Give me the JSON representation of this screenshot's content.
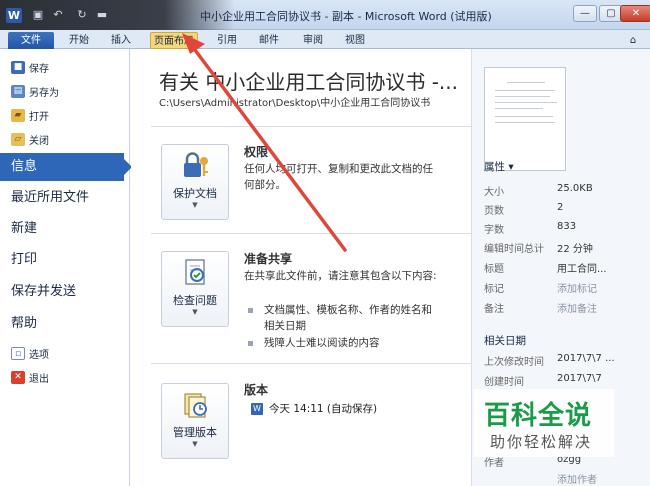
{
  "window": {
    "title": "中小企业用工合同协议书 - 副本 - Microsoft Word (试用版)",
    "controls": [
      "—",
      "▢",
      "✕"
    ]
  },
  "ribbon_tabs": [
    "文件",
    "开始",
    "插入",
    "页面布局",
    "引用",
    "邮件",
    "审阅",
    "视图"
  ],
  "left_nav": {
    "small_items": [
      {
        "label": "保存",
        "icon": "save-icon"
      },
      {
        "label": "另存为",
        "icon": "save-as-icon"
      },
      {
        "label": "打开",
        "icon": "open-folder-icon"
      },
      {
        "label": "关闭",
        "icon": "close-folder-icon"
      }
    ],
    "big_items": [
      "信息",
      "最近所用文件",
      "新建",
      "打印",
      "保存并发送",
      "帮助"
    ],
    "bottom_items": [
      {
        "label": "选项",
        "icon": "options-icon"
      },
      {
        "label": "退出",
        "icon": "exit-icon"
      }
    ]
  },
  "info": {
    "doc_title": "有关 中小企业用工合同协议书 -...",
    "doc_path": "C:\\Users\\Administrator\\Desktop\\中小企业用工合同协议书",
    "sections": [
      {
        "button": "保护文档",
        "title": "权限",
        "desc": "任何人均可打开、复制和更改此文档的任何部分。"
      },
      {
        "button": "检查问题",
        "title": "准备共享",
        "desc": "在共享此文件前，请注意其包含以下内容:",
        "bullets": [
          "文档属性、模板名称、作者的姓名和相关日期",
          "残障人士难以阅读的内容"
        ]
      },
      {
        "button": "管理版本",
        "title": "版本",
        "entry": "今天 14:11 (自动保存)"
      }
    ]
  },
  "properties": {
    "header": "属性 ▾",
    "rows": [
      {
        "k": "大小",
        "v": "25.0KB"
      },
      {
        "k": "页数",
        "v": "2"
      },
      {
        "k": "字数",
        "v": "833"
      },
      {
        "k": "编辑时间总计",
        "v": "22 分钟"
      },
      {
        "k": "标题",
        "v": "用工合同..."
      },
      {
        "k": "标记",
        "v": "添加标记"
      },
      {
        "k": "备注",
        "v": "添加备注"
      }
    ],
    "related_header": "相关日期",
    "related_rows": [
      {
        "k": "上次修改时间",
        "v": "2017\\7\\7 ..."
      },
      {
        "k": "创建时间",
        "v": "2017\\7\\7"
      }
    ],
    "bottom_rows": [
      {
        "k": "作者",
        "v": "ozgg"
      },
      {
        "k": "",
        "v": "添加作者"
      }
    ]
  },
  "watermark": {
    "main": "百科全说",
    "sub": "助你轻松解决"
  },
  "colors": {
    "accent": "#2f67b8",
    "watermark": "#1a9b48",
    "arrow": "#e0463a"
  }
}
